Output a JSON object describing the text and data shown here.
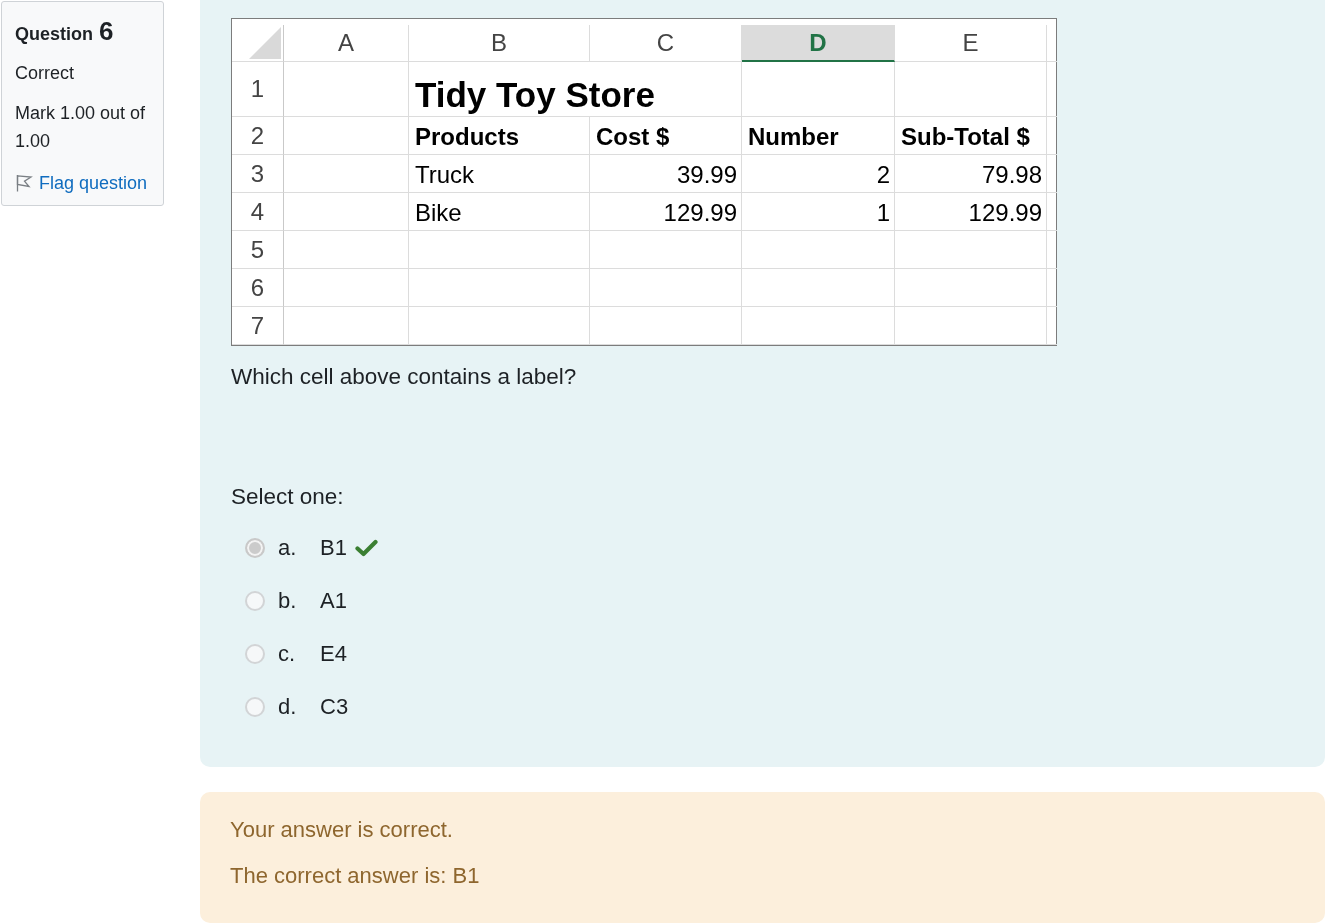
{
  "question_info": {
    "label": "Question",
    "number": "6",
    "state": "Correct",
    "mark": "Mark 1.00 out of 1.00",
    "flag": {
      "label": "Flag question",
      "flagged": false
    }
  },
  "question": {
    "spreadsheet": {
      "columns": [
        {
          "label": "A",
          "selected": false
        },
        {
          "label": "B",
          "selected": false
        },
        {
          "label": "C",
          "selected": false
        },
        {
          "label": "D",
          "selected": true
        },
        {
          "label": "E",
          "selected": false
        }
      ],
      "rows": [
        {
          "label": "1",
          "cells": [
            {
              "kind": "empty"
            },
            {
              "kind": "title",
              "text": "Tidy Toy Store"
            }
          ]
        },
        {
          "label": "2",
          "cells": [
            {
              "kind": "empty"
            },
            {
              "kind": "header",
              "text": "Products"
            },
            {
              "kind": "header",
              "text": "Cost $"
            },
            {
              "kind": "header",
              "text": "Number"
            },
            {
              "kind": "header",
              "text": "Sub-Total $"
            }
          ]
        },
        {
          "label": "3",
          "cells": [
            {
              "kind": "empty"
            },
            {
              "kind": "text",
              "text": "Truck"
            },
            {
              "kind": "number",
              "text": "39.99"
            },
            {
              "kind": "number",
              "text": "2"
            },
            {
              "kind": "number",
              "text": "79.98"
            }
          ]
        },
        {
          "label": "4",
          "cells": [
            {
              "kind": "empty"
            },
            {
              "kind": "text",
              "text": "Bike"
            },
            {
              "kind": "number",
              "text": "129.99"
            },
            {
              "kind": "number",
              "text": "1"
            },
            {
              "kind": "number",
              "text": "129.99"
            }
          ]
        },
        {
          "label": "5"
        },
        {
          "label": "6"
        },
        {
          "label": "7"
        }
      ]
    },
    "text": "Which cell above contains a label?",
    "instruction": "Select one:",
    "answers": [
      {
        "letter": "a.",
        "text": "B1",
        "selected": true,
        "correct": true
      },
      {
        "letter": "b.",
        "text": "A1",
        "selected": false,
        "correct": false
      },
      {
        "letter": "c.",
        "text": "E4",
        "selected": false,
        "correct": false
      },
      {
        "letter": "d.",
        "text": "C3",
        "selected": false,
        "correct": false
      }
    ]
  },
  "feedback": {
    "message": "Your answer is correct.",
    "right_answer": "The correct answer is: B1"
  }
}
